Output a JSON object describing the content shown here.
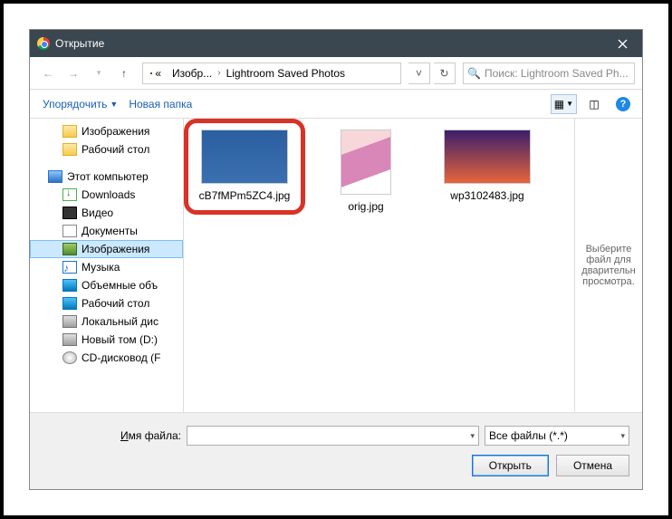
{
  "title": "Открытие",
  "nav": {
    "path_seg1": "Изобр...",
    "path_seg2": "Lightroom Saved Photos",
    "search_placeholder": "Поиск: Lightroom Saved Ph..."
  },
  "toolbar": {
    "organize": "Упорядочить",
    "newfolder": "Новая папка"
  },
  "tree": {
    "images": "Изображения",
    "desktop": "Рабочий стол",
    "thispc": "Этот компьютер",
    "downloads": "Downloads",
    "video": "Видео",
    "documents": "Документы",
    "images2": "Изображения",
    "music": "Музыка",
    "volumes": "Объемные объ",
    "desktop2": "Рабочий стол",
    "localdisk": "Локальный дис",
    "newvol": "Новый том (D:)",
    "cddrive": "CD-дисковод (F"
  },
  "files": {
    "f1": "cB7fMPm5ZC4.jpg",
    "f2": "orig.jpg",
    "f3": "wp3102483.jpg"
  },
  "preview": "Выберите файл для дварительн просмотра.",
  "bottom": {
    "filename_label": "Имя файла:",
    "filter": "Все файлы (*.*)",
    "open": "Открыть",
    "cancel": "Отмена"
  }
}
